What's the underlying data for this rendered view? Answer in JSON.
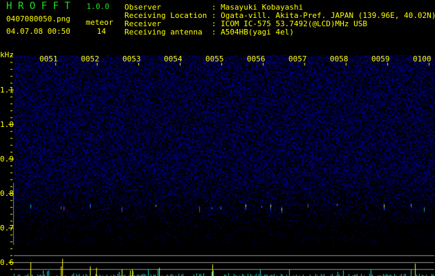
{
  "header": {
    "app_title": "H R O F F T",
    "version": "1.0.0",
    "filename": "0407080050.png",
    "datetime": "04.07.08 00:50",
    "meteor_label": "meteor",
    "meteor_count": "14"
  },
  "info": [
    {
      "label": "Observer           :",
      "value": "Masayuki Kobayashi"
    },
    {
      "label": "Receiving Location :",
      "value": "Ogata-vill. Akita-Pref. JAPAN (139.96E, 40.02N)"
    },
    {
      "label": "Receiver           :",
      "value": "ICOM IC-575 53.7492(@LCD)MHz USB"
    },
    {
      "label": "Receiving antenna  :",
      "value": "A504HB(yagi 4el)"
    }
  ],
  "axis": {
    "unit": "kHz",
    "freq_labels": [
      "1.1",
      "1.0",
      "0.9",
      "0.8",
      "0.7",
      "0.6"
    ],
    "time_labels": [
      "0051",
      "0052",
      "0053",
      "0054",
      "0055",
      "0056",
      "0057",
      "0058",
      "0059",
      "0100"
    ]
  },
  "colors": {
    "text": "#ffff00",
    "title": "#22dd22",
    "noise": "#2020c0",
    "histogram": "#00e0e0",
    "meteor_bar": "#ffff00"
  }
}
